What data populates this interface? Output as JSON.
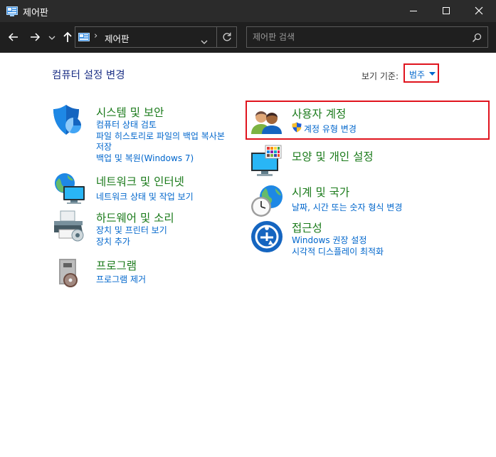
{
  "window": {
    "title": "제어판"
  },
  "address": {
    "path": "제어판",
    "search_placeholder": "제어판 검색"
  },
  "header": {
    "heading": "컴퓨터 설정 변경",
    "view_by_label": "보기 기준:",
    "view_by_value": "범주"
  },
  "categories": {
    "system": {
      "title": "시스템 및 보안",
      "links": [
        "컴퓨터 상태 검토",
        "파일 히스토리로 파일의 백업 복사본",
        "저장",
        "백업 및 복원(Windows 7)"
      ]
    },
    "network": {
      "title": "네트워크 및 인터넷",
      "links": [
        "네트워크 상태 및 작업 보기"
      ]
    },
    "hardware": {
      "title": "하드웨어 및 소리",
      "links": [
        "장치 및 프린터 보기",
        "장치 추가"
      ]
    },
    "programs": {
      "title": "프로그램",
      "links": [
        "프로그램 제거"
      ]
    },
    "user": {
      "title": "사용자 계정",
      "links": [
        "계정 유형 변경"
      ]
    },
    "appearance": {
      "title": "모양 및 개인 설정",
      "links": []
    },
    "clock": {
      "title": "시계 및 국가",
      "links": [
        "날짜, 시간 또는 숫자 형식 변경"
      ]
    },
    "ease": {
      "title": "접근성",
      "links": [
        "Windows 권장 설정",
        "시각적 디스플레이 최적화"
      ]
    }
  },
  "colors": {
    "title_text": "#1a7a1a",
    "link_text": "#0066cc",
    "heading_text": "#1e3287",
    "highlight": "#e0141e",
    "titlebar": "#2b2b2b"
  }
}
